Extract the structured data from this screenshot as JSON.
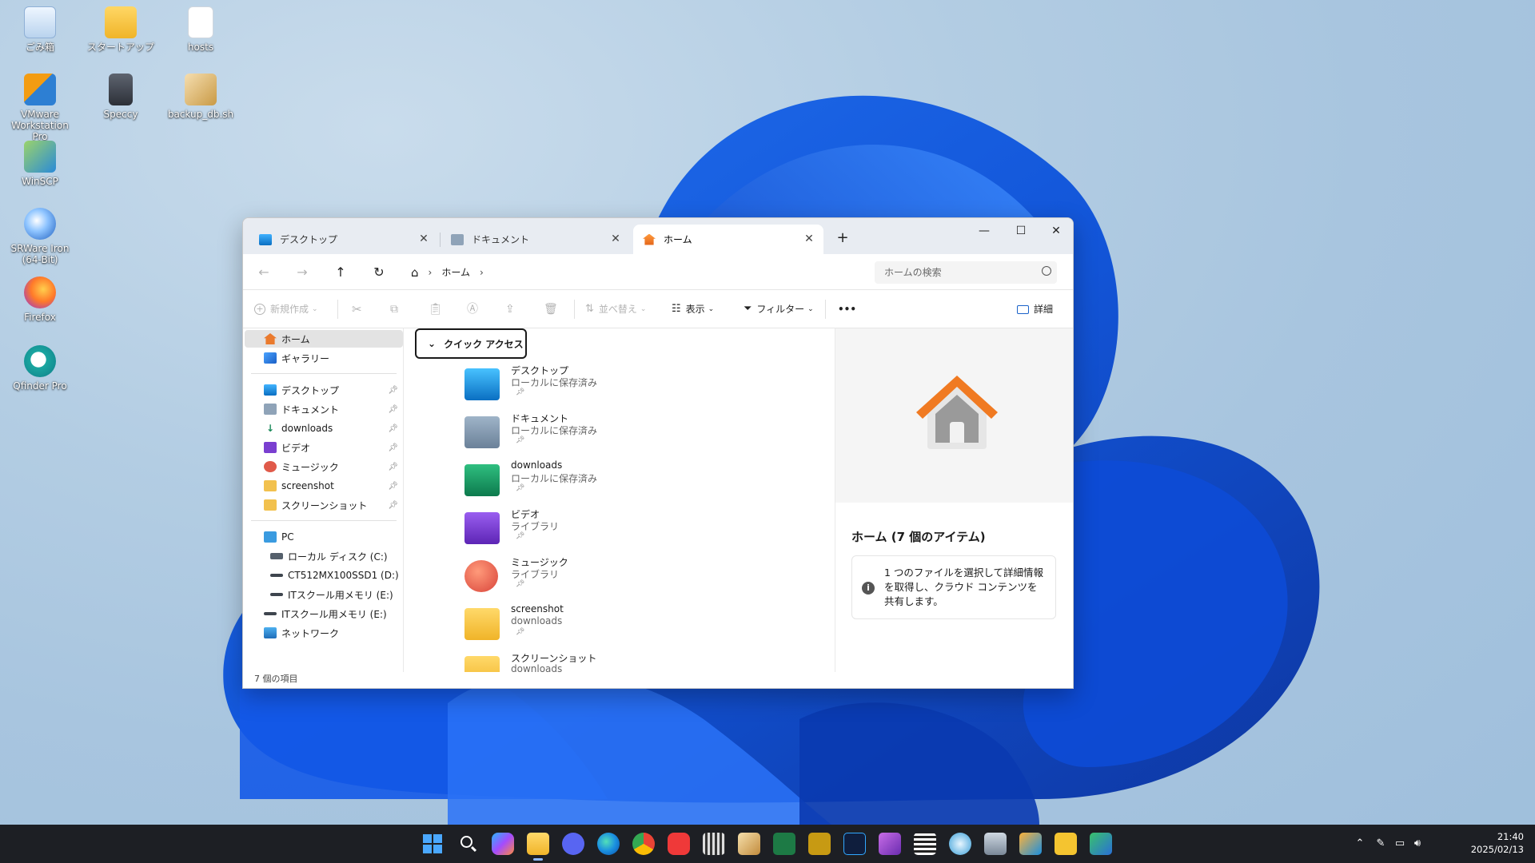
{
  "desktop": {
    "icons": [
      {
        "label": "ごみ箱"
      },
      {
        "label": "スタートアップ"
      },
      {
        "label": "hosts"
      },
      {
        "label": "VMware Workstation Pro"
      },
      {
        "label": "Speccy"
      },
      {
        "label": "backup_db.sh"
      },
      {
        "label": "WinSCP"
      },
      {
        "label": "SRWare Iron (64-Bit)"
      },
      {
        "label": "Firefox"
      },
      {
        "label": "Qfinder Pro"
      }
    ]
  },
  "explorer": {
    "tabs": [
      {
        "label": "デスクトップ",
        "icon": "desktop-icon",
        "active": false
      },
      {
        "label": "ドキュメント",
        "icon": "document-icon",
        "active": false
      },
      {
        "label": "ホーム",
        "icon": "home-icon",
        "active": true
      }
    ],
    "new_tab_glyph": "+",
    "window_controls": {
      "minimize": "—",
      "maximize": "☐",
      "close": "✕"
    },
    "address": {
      "segments": [
        "ホーム"
      ]
    },
    "search": {
      "placeholder": "ホームの検索"
    },
    "toolbar": {
      "new_label": "新規作成",
      "sort_label": "並べ替え",
      "view_label": "表示",
      "filter_label": "フィルター",
      "more_label": "•••",
      "details_label": "詳細"
    },
    "sidebar": {
      "top": [
        {
          "label": "ホーム",
          "icon": "home-icon",
          "selected": true
        },
        {
          "label": "ギャラリー",
          "icon": "gallery-icon"
        }
      ],
      "pinned": [
        {
          "label": "デスクトップ",
          "icon": "desktop-icon"
        },
        {
          "label": "ドキュメント",
          "icon": "document-icon"
        },
        {
          "label": "downloads",
          "icon": "download-icon"
        },
        {
          "label": "ビデオ",
          "icon": "video-icon"
        },
        {
          "label": "ミュージック",
          "icon": "music-icon"
        },
        {
          "label": "screenshot",
          "icon": "folder-icon"
        },
        {
          "label": "スクリーンショット",
          "icon": "folder-icon"
        }
      ],
      "devices": [
        {
          "label": "PC",
          "icon": "pc-icon"
        },
        {
          "label": "ローカル ディスク (C:)",
          "icon": "drive-icon"
        },
        {
          "label": "CT512MX100SSD1 (D:)",
          "icon": "drive-icon"
        },
        {
          "label": "ITスクール用メモリ (E:)",
          "icon": "usb-drive-icon"
        },
        {
          "label": "ITスクール用メモリ (E:)",
          "icon": "usb-drive-icon"
        },
        {
          "label": "ネットワーク",
          "icon": "network-icon"
        }
      ]
    },
    "quick_access": {
      "header": "クイック アクセス",
      "items": [
        {
          "name": "デスクトップ",
          "sub": "ローカルに保存済み",
          "icon": "desktop-folder-icon"
        },
        {
          "name": "ドキュメント",
          "sub": "ローカルに保存済み",
          "icon": "documents-folder-icon"
        },
        {
          "name": "downloads",
          "sub": "ローカルに保存済み",
          "icon": "downloads-folder-icon"
        },
        {
          "name": "ビデオ",
          "sub": "ライブラリ",
          "icon": "videos-folder-icon"
        },
        {
          "name": "ミュージック",
          "sub": "ライブラリ",
          "icon": "music-folder-icon"
        },
        {
          "name": "screenshot",
          "sub": "downloads",
          "icon": "folder-icon"
        },
        {
          "name": "スクリーンショット",
          "sub": "downloads",
          "icon": "folder-icon"
        }
      ]
    },
    "details_pane": {
      "title": "ホーム (7 個のアイテム)",
      "info": "1 つのファイルを選択して詳細情報を取得し、クラウド コンテンツを共有します。"
    },
    "status": "7 個の項目"
  },
  "taskbar": {
    "apps": [
      "start",
      "search",
      "copilot",
      "file-explorer",
      "discord",
      "edge",
      "chrome",
      "vivaldi",
      "video-editor",
      "feather-app",
      "excel",
      "fireworks",
      "photoshop",
      "affinity",
      "film-app",
      "media-player",
      "photo-app",
      "overlay-app",
      "text-app",
      "network-tool"
    ],
    "clock": {
      "time": "21:40",
      "date": "2025/02/13"
    }
  }
}
